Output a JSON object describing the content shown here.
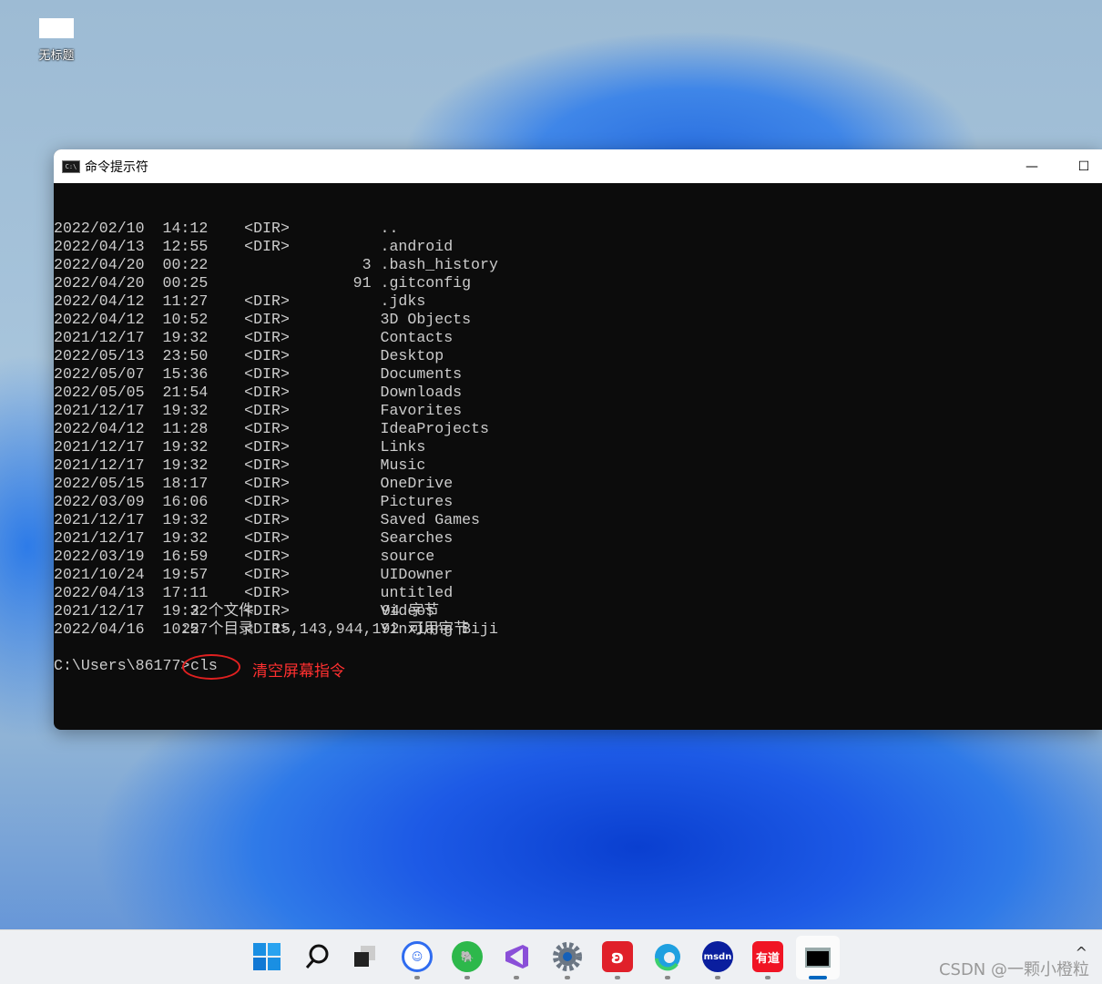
{
  "desktop": {
    "icon_label": "无标题"
  },
  "window": {
    "title": "命令提示符",
    "minimize": "—",
    "maximize": "☐"
  },
  "listing": [
    {
      "date": "2022/02/10",
      "time": "14:12",
      "type": "<DIR>",
      "size": "",
      "name": ".."
    },
    {
      "date": "2022/04/13",
      "time": "12:55",
      "type": "<DIR>",
      "size": "",
      "name": ".android"
    },
    {
      "date": "2022/04/20",
      "time": "00:22",
      "type": "",
      "size": "3",
      "name": ".bash_history"
    },
    {
      "date": "2022/04/20",
      "time": "00:25",
      "type": "",
      "size": "91",
      "name": ".gitconfig"
    },
    {
      "date": "2022/04/12",
      "time": "11:27",
      "type": "<DIR>",
      "size": "",
      "name": ".jdks"
    },
    {
      "date": "2022/04/12",
      "time": "10:52",
      "type": "<DIR>",
      "size": "",
      "name": "3D Objects"
    },
    {
      "date": "2021/12/17",
      "time": "19:32",
      "type": "<DIR>",
      "size": "",
      "name": "Contacts"
    },
    {
      "date": "2022/05/13",
      "time": "23:50",
      "type": "<DIR>",
      "size": "",
      "name": "Desktop"
    },
    {
      "date": "2022/05/07",
      "time": "15:36",
      "type": "<DIR>",
      "size": "",
      "name": "Documents"
    },
    {
      "date": "2022/05/05",
      "time": "21:54",
      "type": "<DIR>",
      "size": "",
      "name": "Downloads"
    },
    {
      "date": "2021/12/17",
      "time": "19:32",
      "type": "<DIR>",
      "size": "",
      "name": "Favorites"
    },
    {
      "date": "2022/04/12",
      "time": "11:28",
      "type": "<DIR>",
      "size": "",
      "name": "IdeaProjects"
    },
    {
      "date": "2021/12/17",
      "time": "19:32",
      "type": "<DIR>",
      "size": "",
      "name": "Links"
    },
    {
      "date": "2021/12/17",
      "time": "19:32",
      "type": "<DIR>",
      "size": "",
      "name": "Music"
    },
    {
      "date": "2022/05/15",
      "time": "18:17",
      "type": "<DIR>",
      "size": "",
      "name": "OneDrive"
    },
    {
      "date": "2022/03/09",
      "time": "16:06",
      "type": "<DIR>",
      "size": "",
      "name": "Pictures"
    },
    {
      "date": "2021/12/17",
      "time": "19:32",
      "type": "<DIR>",
      "size": "",
      "name": "Saved Games"
    },
    {
      "date": "2021/12/17",
      "time": "19:32",
      "type": "<DIR>",
      "size": "",
      "name": "Searches"
    },
    {
      "date": "2022/03/19",
      "time": "16:59",
      "type": "<DIR>",
      "size": "",
      "name": "source"
    },
    {
      "date": "2021/10/24",
      "time": "19:57",
      "type": "<DIR>",
      "size": "",
      "name": "UIDowner"
    },
    {
      "date": "2022/04/13",
      "time": "17:11",
      "type": "<DIR>",
      "size": "",
      "name": "untitled"
    },
    {
      "date": "2021/12/17",
      "time": "19:32",
      "type": "<DIR>",
      "size": "",
      "name": "Videos"
    },
    {
      "date": "2022/04/16",
      "time": "10:57",
      "type": "<DIR>",
      "size": "",
      "name": "Yinxiang Biji"
    }
  ],
  "summary": {
    "files_count": "2 个文件",
    "files_bytes": "94 字节",
    "dirs_count": "22 个目录",
    "free_bytes": "15,143,944,192 可用字节"
  },
  "prompt": {
    "path": "C:\\Users\\86177>",
    "command": "cls"
  },
  "annotation": {
    "text": "清空屏幕指令",
    "color": "#e02020"
  },
  "taskbar": {
    "items": [
      "start",
      "search",
      "task-view",
      "app-blue-face",
      "evernote",
      "visual-studio",
      "settings",
      "netease-music",
      "edge",
      "msdn",
      "youdao",
      "command-prompt"
    ],
    "youdao_label": "有道",
    "msdn_label": "msdn",
    "active_accent": "#0067c0"
  },
  "watermark": "CSDN @一颗小橙粒"
}
